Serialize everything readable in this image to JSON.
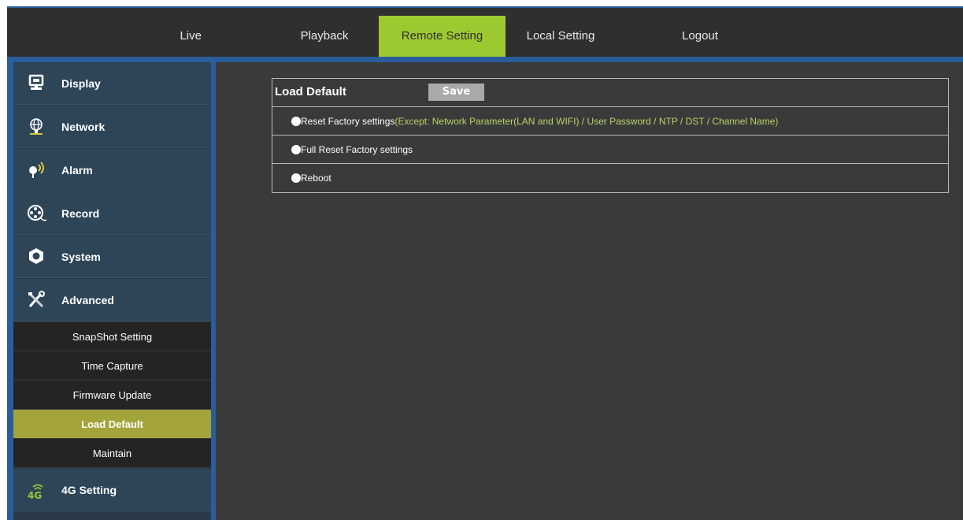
{
  "nav": {
    "tabs": [
      {
        "label": "Live"
      },
      {
        "label": "Playback"
      },
      {
        "label": "Remote Setting"
      },
      {
        "label": "Local Setting"
      },
      {
        "label": "Logout"
      }
    ],
    "active_tab": "Remote Setting"
  },
  "sidebar": {
    "items": [
      {
        "label": "Display",
        "icon": "monitor-icon"
      },
      {
        "label": "Network",
        "icon": "globe-icon"
      },
      {
        "label": "Alarm",
        "icon": "alarm-icon"
      },
      {
        "label": "Record",
        "icon": "film-reel-icon"
      },
      {
        "label": "System",
        "icon": "hex-nut-icon"
      },
      {
        "label": "Advanced",
        "icon": "tools-icon"
      }
    ],
    "advanced_sub": [
      {
        "label": "SnapShot Setting"
      },
      {
        "label": "Time Capture"
      },
      {
        "label": "Firmware Update"
      },
      {
        "label": "Load Default"
      },
      {
        "label": "Maintain"
      }
    ],
    "active_sub": "Load Default",
    "extra_item": {
      "label": "4G Setting",
      "icon": "4g-signal-icon"
    }
  },
  "panel": {
    "title": "Load Default",
    "save_label": "Save",
    "options": [
      {
        "label": "Reset Factory settings",
        "note": "(Except: Network Parameter(LAN and WIFI) / User Password / NTP / DST / Channel Name)"
      },
      {
        "label": "Full Reset Factory settings",
        "note": ""
      },
      {
        "label": "Reboot",
        "note": ""
      }
    ]
  },
  "colors": {
    "accent_green": "#9dc930",
    "active_sub_bg": "#a3a43a",
    "frame_blue": "#2a5d9a",
    "sidebar_bg": "#2e4558",
    "content_bg": "#3a3a3a",
    "note_green": "#b7d468"
  }
}
